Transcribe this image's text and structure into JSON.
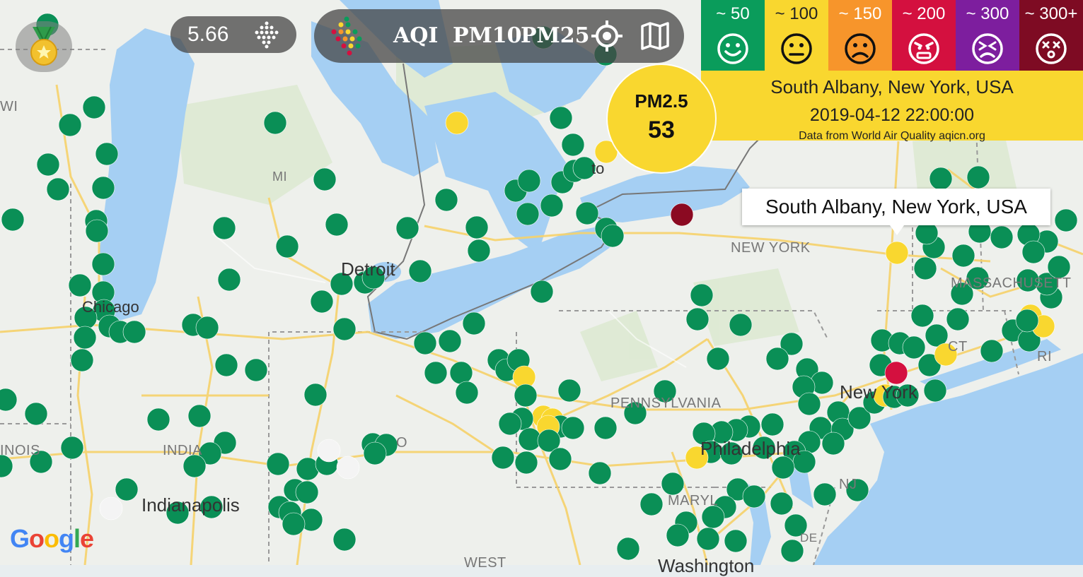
{
  "medal": {
    "icon": "medal-icon"
  },
  "speed": {
    "value": "5.66",
    "icon": "dots-grid-icon"
  },
  "layers": {
    "logo_icon": "colored-dots-icon",
    "aqi_label": "AQI",
    "pm10_label": "PM10",
    "pm25_label": "PM25",
    "locate_icon": "crosshair-icon",
    "map_icon": "map-icon"
  },
  "legend": [
    {
      "range": "~ 50",
      "color": "#0a9c5b",
      "icon": "smile-face-icon"
    },
    {
      "range": "~ 100",
      "color": "#f9d72f",
      "icon": "neutral-face-icon"
    },
    {
      "range": "~ 150",
      "color": "#f7952b",
      "icon": "sad-face-icon"
    },
    {
      "range": "~ 200",
      "color": "#d4103f",
      "icon": "angry-face-icon"
    },
    {
      "range": "~ 300",
      "color": "#7d1e9e",
      "icon": "dizzy-face-icon"
    },
    {
      "range": "~ 300+",
      "color": "#7e0b23",
      "icon": "shocked-face-icon"
    }
  ],
  "info": {
    "location": "South Albany, New York, USA",
    "time": "2019-04-12 22:00:00",
    "source": "Data from World Air Quality aqicn.org"
  },
  "bubble": {
    "label": "PM2.5",
    "value": "53"
  },
  "tooltip": {
    "text": "South Albany, New York, USA"
  },
  "map_labels": {
    "wi": "WI",
    "mi": "MI",
    "new_york": "NEW YORK",
    "pennsylvania": "PENNSYLVANIA",
    "illinois": "INOIS",
    "indiana": "INDIA",
    "ohio": "O",
    "maryland": "MARYL",
    "massachusetts": "MASSACHUSETT",
    "ct": "CT",
    "ri": "RI",
    "nj": "NJ",
    "de": "DE",
    "west": "WEST",
    "toronto": "to",
    "detroit": "Detroit",
    "chicago": "Chicago",
    "indianapolis": "Indianapolis",
    "new_york_city": "New York",
    "philadelphia": "Philadelphia",
    "washington": "Washington"
  },
  "google": {
    "text": "Google"
  }
}
